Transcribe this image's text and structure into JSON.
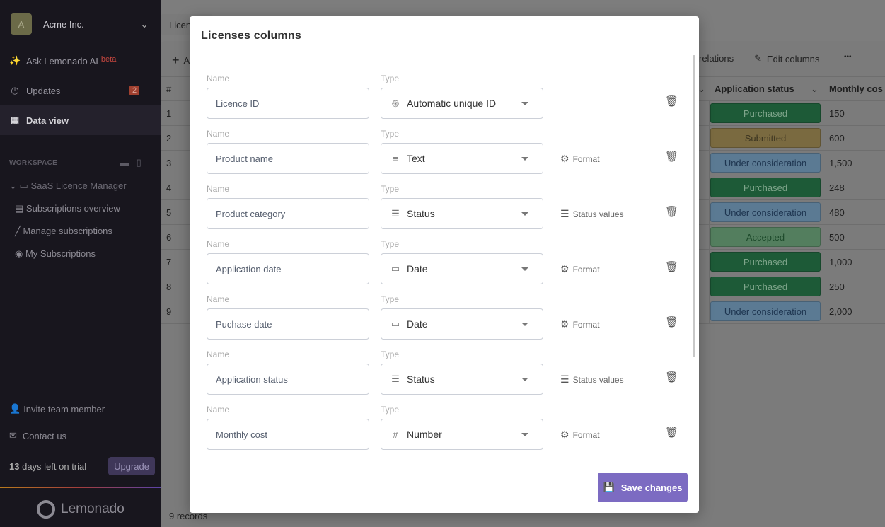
{
  "sidebar": {
    "org_initial": "A",
    "org_name": "Acme Inc.",
    "ai_label": "Ask Lemonado AI",
    "ai_badge": "beta",
    "updates_label": "Updates",
    "updates_count": "2",
    "data_view_label": "Data view",
    "workspace_label": "WORKSPACE",
    "folder": "SaaS Licence Manager",
    "pages": [
      "Subscriptions overview",
      "Manage subscriptions",
      "My Subscriptions"
    ],
    "invite": "Invite team member",
    "contact": "Contact us",
    "trial_days": "13",
    "trial_text": "days left on trial",
    "upgrade": "Upgrade",
    "logo": "Lemonado"
  },
  "main": {
    "tab": "Licen",
    "toolbar": {
      "add": "A",
      "relations": "relations",
      "edit_columns": "Edit columns",
      "more": "•••"
    },
    "headers": {
      "num": "#",
      "status": "Application status",
      "cost": "Monthly cos"
    },
    "rows": [
      {
        "n": "1",
        "status": "Purchased",
        "cost": "150"
      },
      {
        "n": "2",
        "status": "Submitted",
        "cost": "600"
      },
      {
        "n": "3",
        "status": "Under consideration",
        "cost": "1,500"
      },
      {
        "n": "4",
        "status": "Purchased",
        "cost": "248"
      },
      {
        "n": "5",
        "status": "Under consideration",
        "cost": "480"
      },
      {
        "n": "6",
        "status": "Accepted",
        "cost": "500"
      },
      {
        "n": "7",
        "status": "Purchased",
        "cost": "1,000"
      },
      {
        "n": "8",
        "status": "Purchased",
        "cost": "250"
      },
      {
        "n": "9",
        "status": "Under consideration",
        "cost": "2,000"
      }
    ],
    "records": "9 records"
  },
  "status_colors": {
    "Purchased": [
      "#1d5a37",
      "#7fa58b"
    ],
    "Submitted": [
      "#7a6a40",
      "#3b3420"
    ],
    "Under consideration": [
      "#5b7a93",
      "#1e3550"
    ],
    "Accepted": [
      "#537e5e",
      "#1d4a2b"
    ]
  },
  "modal": {
    "title": "Licenses  columns",
    "name_label": "Name",
    "type_label": "Type",
    "save": "Save changes",
    "columns": [
      {
        "name": "Licence ID",
        "type": "Automatic unique ID",
        "icon": "fingerprint-icon",
        "glyph": "֍",
        "action": ""
      },
      {
        "name": "Product name",
        "type": "Text",
        "icon": "text-icon",
        "glyph": "≡",
        "action": "Format"
      },
      {
        "name": "Product category",
        "type": "Status",
        "icon": "checklist-icon",
        "glyph": "☰",
        "action": "Status values"
      },
      {
        "name": "Application date",
        "type": "Date",
        "icon": "calendar-icon",
        "glyph": "▭",
        "action": "Format"
      },
      {
        "name": "Puchase date",
        "type": "Date",
        "icon": "calendar-icon",
        "glyph": "▭",
        "action": "Format"
      },
      {
        "name": "Application status",
        "type": "Status",
        "icon": "checklist-icon",
        "glyph": "☰",
        "action": "Status values"
      },
      {
        "name": "Monthly cost",
        "type": "Number",
        "icon": "hash-icon",
        "glyph": "#",
        "action": "Format"
      }
    ]
  },
  "accent": "#7c6bc2"
}
